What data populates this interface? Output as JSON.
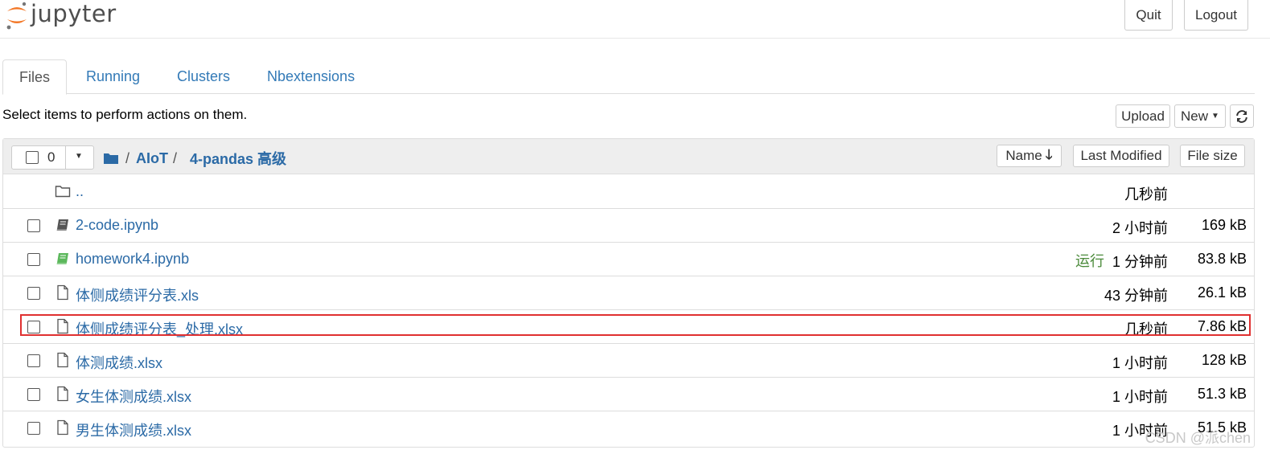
{
  "app": {
    "logo_text": "jupyter"
  },
  "header": {
    "quit_label": "Quit",
    "logout_label": "Logout"
  },
  "tabs": [
    {
      "label": "Files",
      "active": true
    },
    {
      "label": "Running",
      "active": false
    },
    {
      "label": "Clusters",
      "active": false
    },
    {
      "label": "Nbextensions",
      "active": false
    }
  ],
  "toolbar": {
    "hint": "Select items to perform actions on them.",
    "upload_label": "Upload",
    "new_label": "New"
  },
  "list_header": {
    "selected_count": "0",
    "breadcrumb": [
      "AIoT",
      "4-pandas 高级"
    ],
    "sort_name_label": "Name",
    "sort_modified_label": "Last Modified",
    "sort_size_label": "File size"
  },
  "files": [
    {
      "name": "..",
      "type": "folder",
      "modified": "几秒前",
      "size": ""
    },
    {
      "name": "2-code.ipynb",
      "type": "notebook",
      "modified": "2 小时前",
      "size": "169 kB"
    },
    {
      "name": "homework4.ipynb",
      "type": "notebook-running",
      "status": "运行",
      "modified": "1 分钟前",
      "size": "83.8 kB"
    },
    {
      "name": "体侧成绩评分表.xls",
      "type": "file",
      "modified": "43 分钟前",
      "size": "26.1 kB"
    },
    {
      "name": "体侧成绩评分表_处理.xlsx",
      "type": "file",
      "modified": "几秒前",
      "size": "7.86 kB"
    },
    {
      "name": "体测成绩.xlsx",
      "type": "file",
      "modified": "1 小时前",
      "size": "128 kB"
    },
    {
      "name": "女生体测成绩.xlsx",
      "type": "file",
      "modified": "1 小时前",
      "size": "51.3 kB"
    },
    {
      "name": "男生体测成绩.xlsx",
      "type": "file",
      "modified": "1 小时前",
      "size": "51.5 kB"
    }
  ],
  "watermark": "CSDN @派chen",
  "colors": {
    "link": "#2b6aa6",
    "running": "#4a8a3a",
    "highlight": "#e03030",
    "logo_orange": "#f37726"
  }
}
